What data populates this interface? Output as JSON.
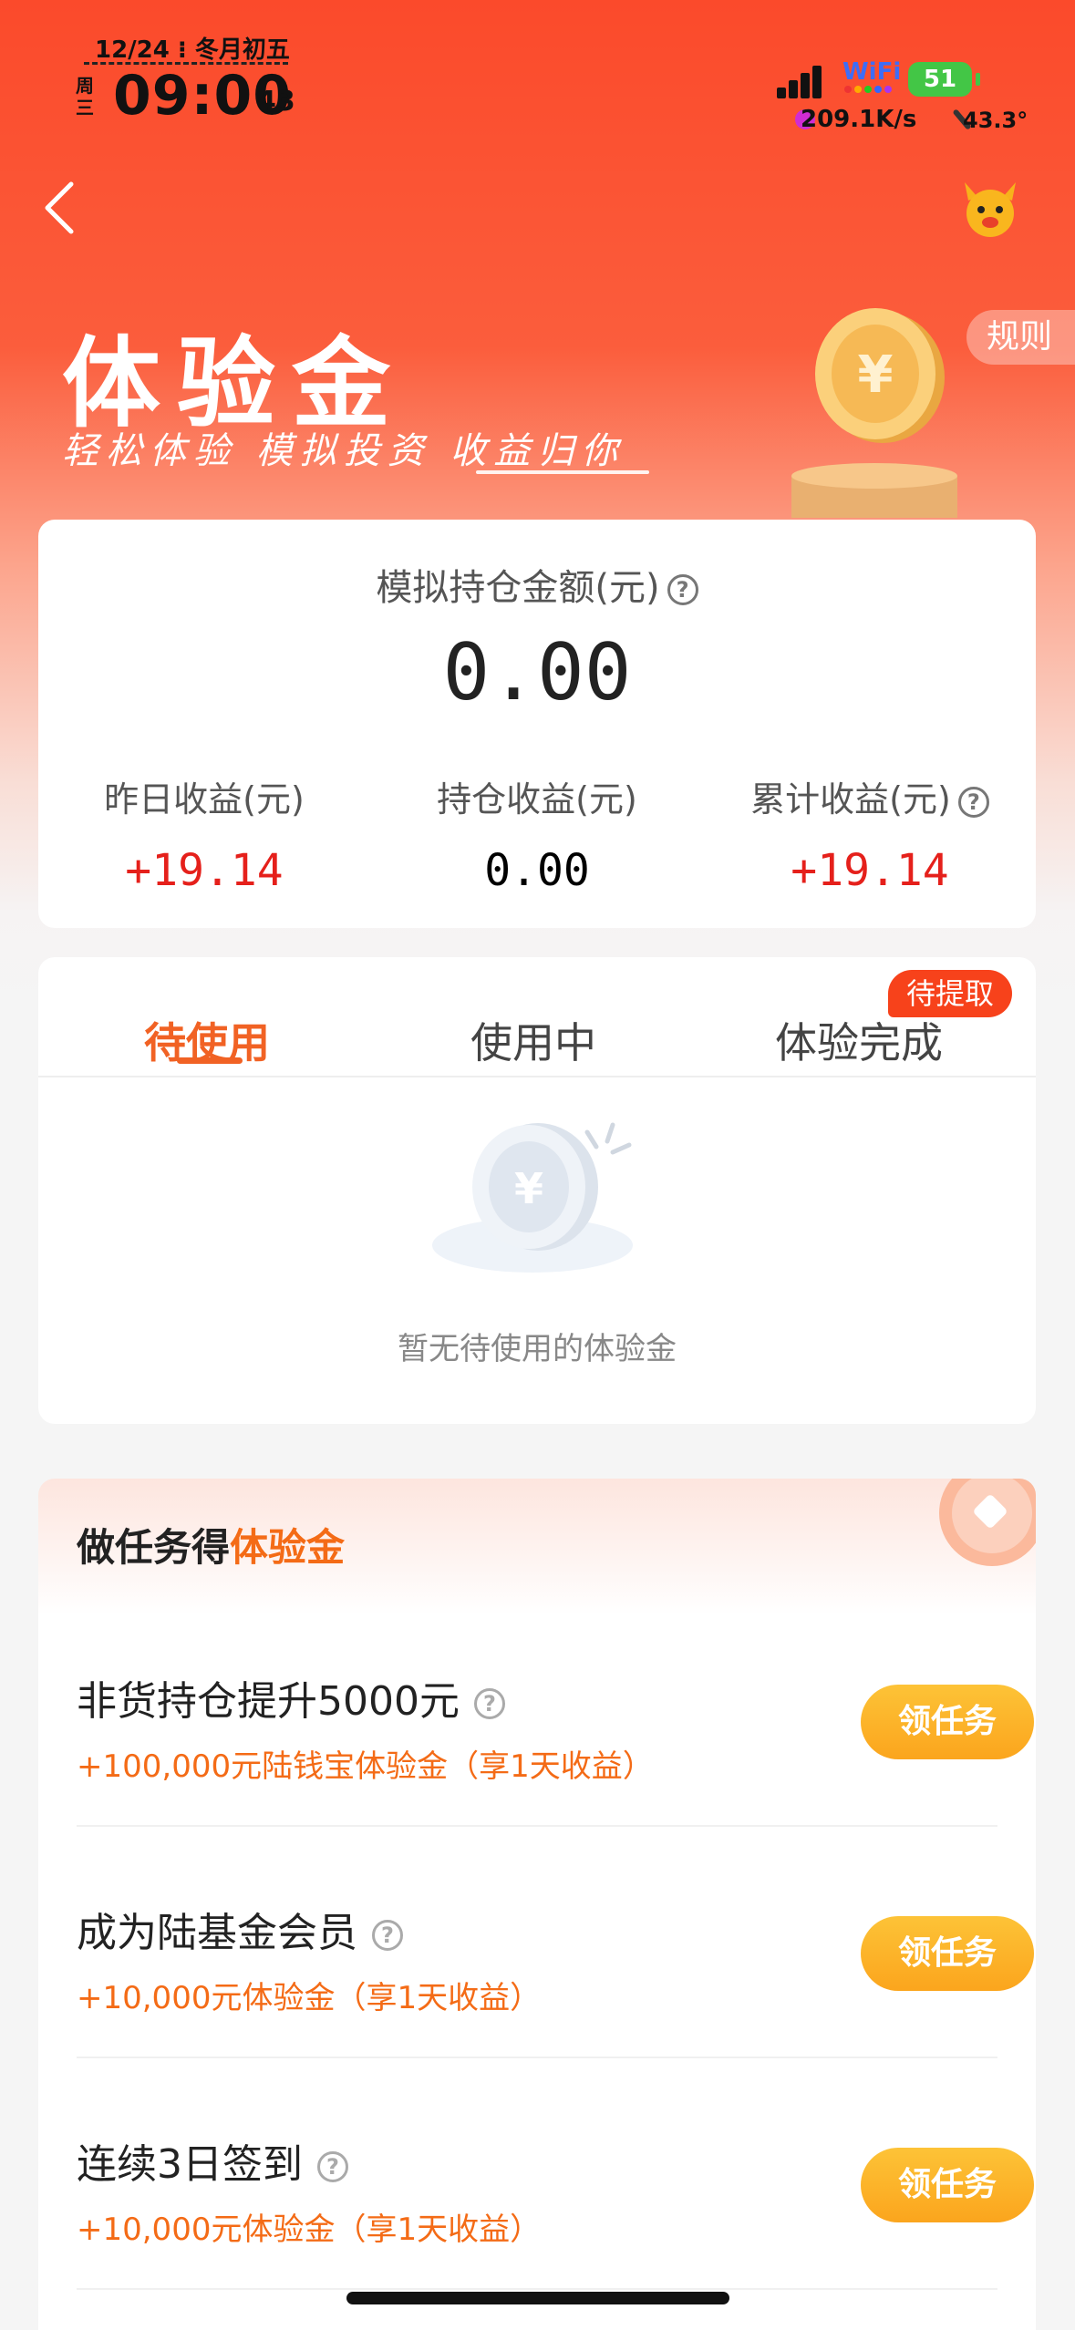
{
  "status_bar": {
    "date": "12/24 ⁝ 冬月初五",
    "weekday": "周三",
    "time": "09:00",
    "seconds": "43",
    "wifi_label": "WiFi",
    "battery": "51",
    "net_speed": "209.1K/s",
    "temperature": "43.3°"
  },
  "nav": {
    "back_icon": "chevron-left-icon",
    "mascot_icon": "mascot-icon"
  },
  "hero": {
    "title": "体验金",
    "subtitle": "轻松体验 模拟投资 收益归你",
    "rules_label": "规则"
  },
  "summary": {
    "label": "模拟持仓金额(元)",
    "value": "0.00",
    "stats": [
      {
        "label": "昨日收益(元)",
        "value": "+19.14"
      },
      {
        "label": "持仓收益(元)",
        "value": "0.00"
      },
      {
        "label": "累计收益(元)",
        "value": "+19.14"
      }
    ]
  },
  "tabs": {
    "items": [
      "待使用",
      "使用中",
      "体验完成"
    ],
    "active_index": 0,
    "badge": "待提取",
    "empty_text": "暂无待使用的体验金"
  },
  "tasks": {
    "title_prefix": "做任务得",
    "title_highlight": "体验金",
    "items": [
      {
        "name": "非货持仓提升5000元",
        "reward": "+100,000元陆钱宝体验金（享1天收益）",
        "button": "领任务"
      },
      {
        "name": "成为陆基金会员",
        "reward": "+10,000元体验金（享1天收益）",
        "button": "领任务"
      },
      {
        "name": "连续3日签到",
        "reward": "+10,000元体验金（享1天收益）",
        "button": "领任务"
      }
    ]
  },
  "colors": {
    "primary": "#fb4a2b",
    "accent": "#f46b16",
    "profit": "#e5201b",
    "button": "#fba51d"
  }
}
